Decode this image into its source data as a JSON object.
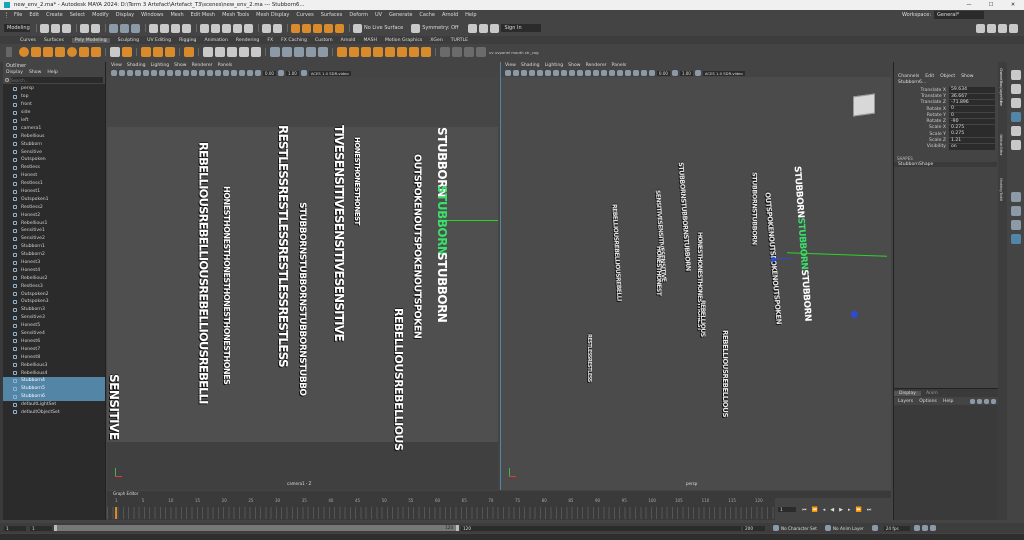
{
  "window": {
    "title": "new_env_2.ma* - Autodesk MAYA 2024: D:\\Term 3 Artefact\\Artefact_T3\\scenes\\new_env_2.ma   ---   Stubborn6...",
    "controls": [
      "—",
      "☐",
      "✕"
    ]
  },
  "menubar": {
    "items": [
      "File",
      "Edit",
      "Create",
      "Select",
      "Modify",
      "Display",
      "Windows",
      "Mesh",
      "Edit Mesh",
      "Mesh Tools",
      "Mesh Display",
      "Curves",
      "Surfaces",
      "Deform",
      "UV",
      "Generate",
      "Cache",
      "Arnold",
      "Help"
    ],
    "workspace_label": "Workspace:",
    "workspace_value": "General*"
  },
  "statusline": {
    "mode": "Modeling",
    "no_live_surface": "No Live Surface",
    "symmetry": "Symmetry: Off",
    "sign_in": "Sign In"
  },
  "shelf": {
    "tabs": [
      "Curves",
      "Surfaces",
      "Poly Modeling",
      "Sculpting",
      "UV Editing",
      "Rigging",
      "Animation",
      "Rendering",
      "FX",
      "FX Caching",
      "Custom",
      "Arnold",
      "MASH",
      "Motion Graphics",
      "XGen",
      "TURTLE"
    ],
    "active_tab": "Poly Modeling",
    "trailing_label": "uv  uvpanel mouth  str_cog"
  },
  "outliner": {
    "title": "Outliner",
    "menu": [
      "Display",
      "Show",
      "Help"
    ],
    "search_placeholder": "Search...",
    "items": [
      "persp",
      "top",
      "front",
      "side",
      "left",
      "camera1",
      "Rebellious",
      "Stubborn",
      "Sensitive",
      "Outspoken",
      "Restless",
      "Honest",
      "Restless1",
      "Honest1",
      "Outspoken1",
      "Restless2",
      "Honest2",
      "Rebellious1",
      "Sensitive1",
      "Sensitive2",
      "Stubborn1",
      "Stubborn2",
      "Honest3",
      "Honest4",
      "Rebellious2",
      "Restless3",
      "Outspoken2",
      "Outspoken3",
      "Stubborn3",
      "Sensitive3",
      "Honest5",
      "Sensitive4",
      "Honest6",
      "Honest7",
      "Honest8",
      "Rebellious3",
      "Rebellious4",
      "Stubborn4",
      "Stubborn5",
      "Stubborn6",
      "defaultLightSet",
      "defaultObjectSet"
    ],
    "selected": [
      "Stubborn4",
      "Stubborn5",
      "Stubborn6"
    ]
  },
  "viewport_left": {
    "menu": [
      "View",
      "Shading",
      "Lighting",
      "Show",
      "Renderer",
      "Panels"
    ],
    "field_a": "0.00",
    "field_b": "1.00",
    "color_space": "ACES 1.0 SDR-video",
    "camera_label": "camera1 - Z",
    "words": [
      "SENSITIVE",
      "REBELLIOUSREBELLIOUSREBELLIOUSREBELLI",
      "HONESTHONESTHONESTHONESTHONESTHONES",
      "RESTLESSRESTLESSRESTLESSRESTLESS",
      "STUBBORNSTUBBORNSTUBBORNSTUBBO",
      "TIVESENSITIVESENSITIVESENSITIVE",
      "HONESTHONESTHONEST",
      "REBELLIOUSREBELLIOUS",
      "OUTSPOKENOUTSPOKENOUTSPOKEN",
      "STUBBORN",
      "STUBBORN",
      "STUBBORN"
    ]
  },
  "viewport_right": {
    "menu": [
      "View",
      "Shading",
      "Lighting",
      "Show",
      "Renderer",
      "Panels"
    ],
    "field_a": "0.00",
    "field_b": "1.00",
    "color_space": "ACES 1.0 SDR-video",
    "camera_label": "persp",
    "words": [
      "REBELLIOUSREBELLIOUSREBELLI",
      "RESTLESSRESTLESS",
      "SENSITIVESENSITIVESENSITIVE",
      "STUBBORNSTUBBORNSTUBBORN",
      "HONESTHONESTHONESTHONEST",
      "OUTSPOKENOUTSPOKENOUTSPOKEN",
      "STUBBORNSTUBBORN",
      "REBELLIOUSREBELLIOUS",
      "HONESTHONEST",
      "REBELLIOUS"
    ]
  },
  "channelbox": {
    "menu": [
      "Channels",
      "Edit",
      "Object",
      "Show"
    ],
    "object": "Stubborn6...",
    "channels": [
      {
        "label": "Translate X",
        "value": "59.634"
      },
      {
        "label": "Translate Y",
        "value": "36.667"
      },
      {
        "label": "Translate Z",
        "value": "-71.896"
      },
      {
        "label": "Rotate X",
        "value": "0"
      },
      {
        "label": "Rotate Y",
        "value": "0"
      },
      {
        "label": "Rotate Z",
        "value": "-90"
      },
      {
        "label": "Scale X",
        "value": "0.275"
      },
      {
        "label": "Scale Y",
        "value": "0.275"
      },
      {
        "label": "Scale Z",
        "value": "1.21"
      },
      {
        "label": "Visibility",
        "value": "on"
      }
    ],
    "shapes_label": "SHAPES",
    "shape_name": "StubbornShape",
    "layer_tabs": [
      "Display",
      "Anim"
    ],
    "layer_menu": [
      "Layers",
      "Options",
      "Help"
    ]
  },
  "right_tabs": [
    "Channel Box / Layer Editor",
    "Attribute Editor",
    "Modeling Toolkit"
  ],
  "timeline": {
    "graph_label": "Graph Editor",
    "ticks": [
      "1",
      "5",
      "10",
      "15",
      "20",
      "25",
      "30",
      "35",
      "40",
      "45",
      "50",
      "55",
      "60",
      "65",
      "70",
      "75",
      "80",
      "85",
      "90",
      "95",
      "100",
      "105",
      "110",
      "115",
      "120"
    ],
    "current_frame": "1"
  },
  "rangebar": {
    "start": "1",
    "inner_start": "1",
    "inner_end": "120",
    "end_a": "120",
    "end_b": "200",
    "character_set": "No Character Set",
    "anim_layer": "No Anim Layer",
    "fps": "24 fps"
  },
  "colors": {
    "selection": "#5285a6",
    "accent_orange": "#d98a2b",
    "highlight_green": "#39e06a"
  }
}
